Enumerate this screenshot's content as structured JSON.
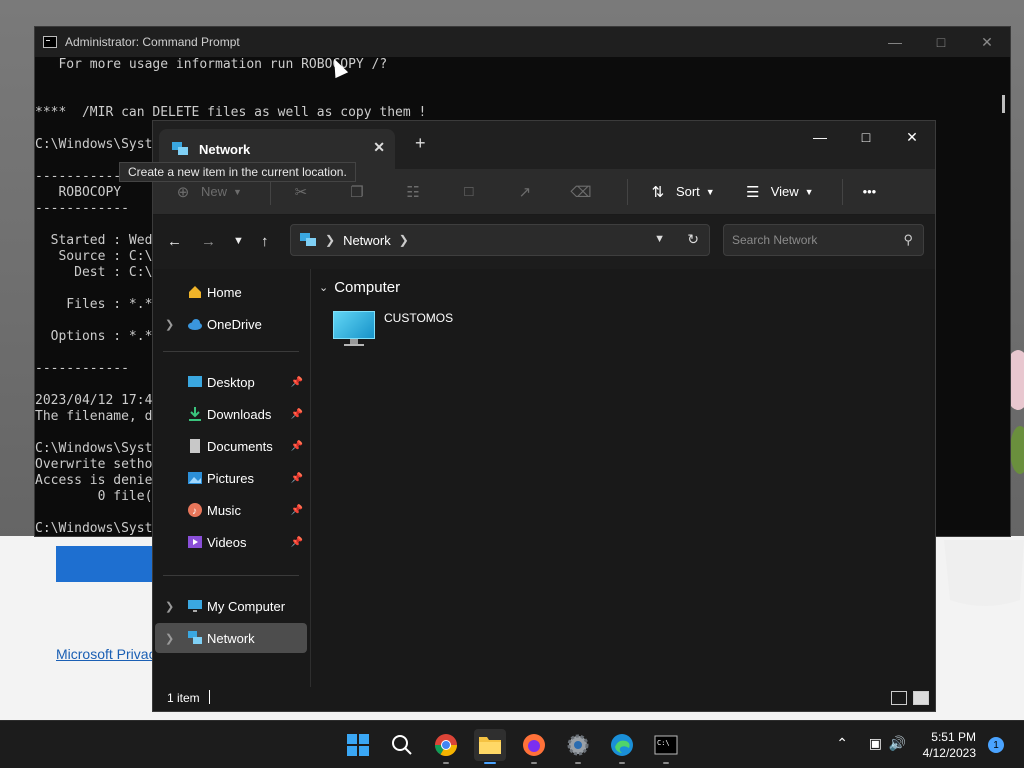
{
  "background": {
    "privacy_link": "Microsoft Privac"
  },
  "cmd": {
    "title": "Administrator: Command Prompt",
    "lines": [
      "   For more usage information run ROBOCOPY /?",
      "",
      "",
      "****  /MIR can DELETE files as well as copy them !",
      "",
      "C:\\Windows\\Syst",
      "",
      "------------",
      "   ROBOCOPY",
      "------------",
      "",
      "  Started : Wed",
      "   Source : C:\\",
      "     Dest : C:\\",
      "",
      "    Files : *.*",
      "",
      "  Options : *.*",
      "",
      "------------",
      "",
      "2023/04/12 17:4",
      "The filename, d",
      "",
      "C:\\Windows\\Syst",
      "Overwrite setho",
      "Access is denie",
      "        0 file(",
      "",
      "C:\\Windows\\Syst"
    ]
  },
  "explorer": {
    "tab_label": "Network",
    "tooltip": "Create a new item in the current location.",
    "toolbar": {
      "new_label": "New",
      "sort_label": "Sort",
      "view_label": "View",
      "more_label": "•••"
    },
    "address": {
      "crumb": "Network"
    },
    "search": {
      "placeholder": "Search Network"
    },
    "nav": {
      "home": "Home",
      "onedrive": "OneDrive",
      "desktop": "Desktop",
      "downloads": "Downloads",
      "documents": "Documents",
      "pictures": "Pictures",
      "music": "Music",
      "videos": "Videos",
      "my_computer": "My Computer",
      "network": "Network"
    },
    "content": {
      "group": "Computer",
      "items": [
        {
          "name": "CUSTOMOS"
        }
      ]
    },
    "status": "1 item"
  },
  "taskbar": {
    "time": "5:51 PM",
    "date": "4/12/2023",
    "notification_count": "1"
  }
}
